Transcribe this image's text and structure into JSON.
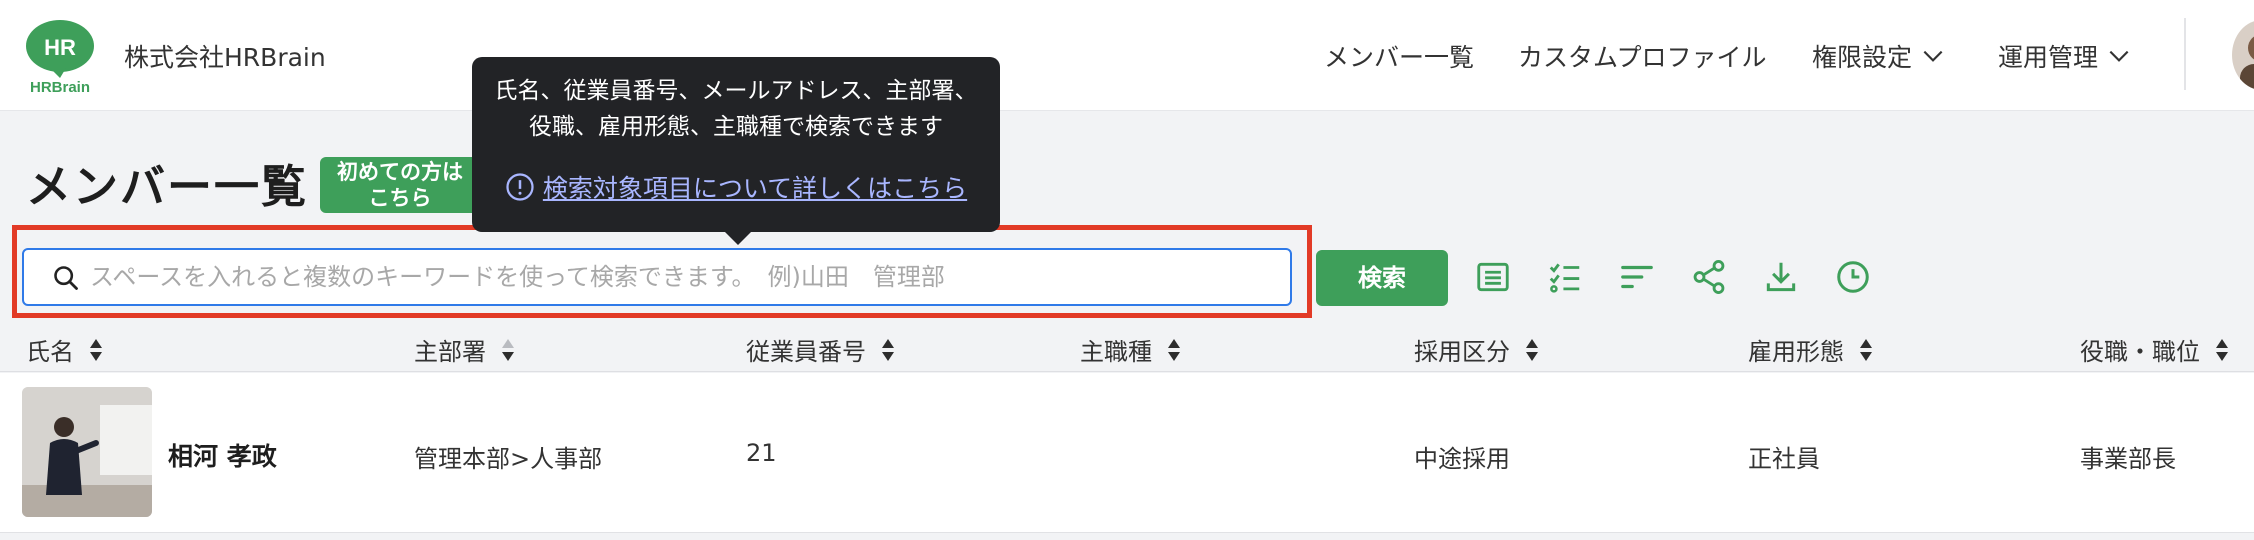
{
  "header": {
    "logo_text_top": "HR",
    "logo_text_bottom": "HRBrain",
    "company": "株式会社HRBrain",
    "nav": [
      {
        "label": "メンバー一覧"
      },
      {
        "label": "カスタムプロファイル"
      },
      {
        "label": "権限設定"
      },
      {
        "label": "運用管理"
      }
    ]
  },
  "page": {
    "title": "メンバー一覧",
    "guide_button": {
      "line1": "初めての方は",
      "line2": "こちら"
    }
  },
  "tooltip": {
    "line1": "氏名、従業員番号、メールアドレス、主部署、",
    "line2": "役職、雇用形態、主職種で検索できます",
    "link": "検索対象項目について詳しくはこちら"
  },
  "search": {
    "placeholder": "スペースを入れると複数のキーワードを使って検索できます。　例)山田　管理部",
    "value": "",
    "button": "検索"
  },
  "toolbar_icons": [
    "list-view-icon",
    "checklist-icon",
    "sort-lines-icon",
    "share-icon",
    "download-icon",
    "history-clock-icon"
  ],
  "table": {
    "columns": [
      "氏名",
      "主部署",
      "従業員番号",
      "主職種",
      "採用区分",
      "雇用形態",
      "役職・職位"
    ],
    "rows": [
      {
        "name": "相河 孝政",
        "department": "管理本部>人事部",
        "employee_no": "21",
        "job_type": "",
        "hiring": "中途採用",
        "employment": "正社員",
        "position": "事業部長"
      }
    ]
  },
  "colors": {
    "brand_green": "#3e9f5a",
    "highlight_red": "#e23a26",
    "tooltip_bg": "#222326",
    "link": "#a9b6ff"
  }
}
